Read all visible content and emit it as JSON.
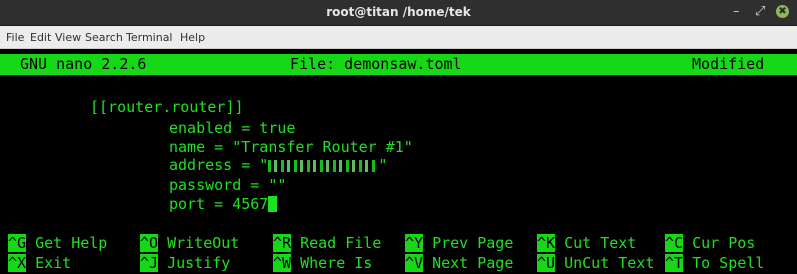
{
  "window": {
    "title": "root@titan /home/tek",
    "minimize_glyph": "–",
    "maximize_glyph": "⤢",
    "close_glyph": "✖"
  },
  "menu": {
    "items": [
      "File",
      "Edit",
      "View",
      "Search",
      "Terminal",
      "Help"
    ]
  },
  "nano": {
    "version": "GNU nano 2.2.6",
    "file": "File: demonsaw.toml",
    "status": "Modified"
  },
  "editor": {
    "lines": [
      "[[router.router]]",
      "enabled = true",
      "name = \"Transfer Router #1\"",
      "address = \"",
      "password = \"\"",
      "port = 4567"
    ],
    "address_close": "\""
  },
  "shortcuts": {
    "row1": [
      {
        "key": "^G",
        "label": "Get Help"
      },
      {
        "key": "^O",
        "label": "WriteOut"
      },
      {
        "key": "^R",
        "label": "Read File"
      },
      {
        "key": "^Y",
        "label": "Prev Page"
      },
      {
        "key": "^K",
        "label": "Cut Text"
      },
      {
        "key": "^C",
        "label": "Cur Pos"
      }
    ],
    "row2": [
      {
        "key": "^X",
        "label": "Exit"
      },
      {
        "key": "^J",
        "label": "Justify"
      },
      {
        "key": "^W",
        "label": "Where Is"
      },
      {
        "key": "^V",
        "label": "Next Page"
      },
      {
        "key": "^U",
        "label": "UnCut Text"
      },
      {
        "key": "^T",
        "label": "To Spell"
      }
    ]
  },
  "colors": {
    "terminal_fg": "#1fe01f",
    "header_bg": "#16d816",
    "terminal_bg": "#000000"
  }
}
